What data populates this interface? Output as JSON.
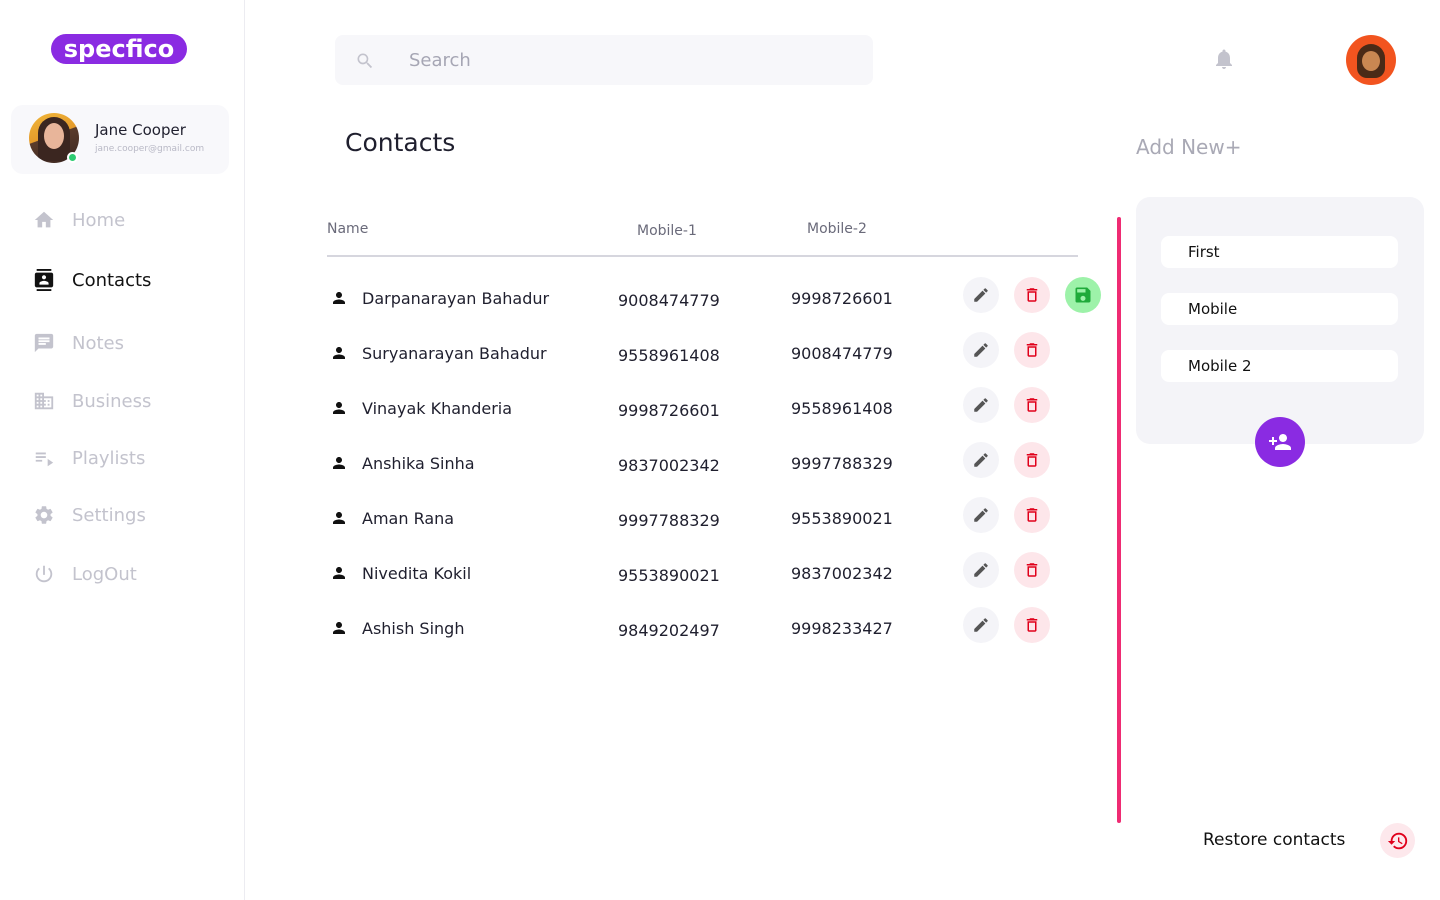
{
  "app": {
    "logo_text": "specfico"
  },
  "user": {
    "name": "Jane Cooper",
    "email": "jane.cooper@gmail.com"
  },
  "sidebar": {
    "items": [
      {
        "label": "Home",
        "icon": "home-icon"
      },
      {
        "label": "Contacts",
        "icon": "contacts-icon",
        "active": true
      },
      {
        "label": "Notes",
        "icon": "notes-icon"
      },
      {
        "label": "Business",
        "icon": "business-icon"
      },
      {
        "label": "Playlists",
        "icon": "playlist-icon"
      },
      {
        "label": "Settings",
        "icon": "gear-icon"
      },
      {
        "label": "LogOut",
        "icon": "power-icon"
      }
    ]
  },
  "search": {
    "placeholder": "Search"
  },
  "page": {
    "title": "Contacts",
    "add_new_label": "Add New+"
  },
  "table": {
    "headers": {
      "name": "Name",
      "mobile1": "Mobile-1",
      "mobile2": "Mobile-2"
    },
    "rows": [
      {
        "name": "Darpanarayan Bahadur",
        "mobile1": "9008474779",
        "mobile2": "9998726601",
        "has_save": true
      },
      {
        "name": "Suryanarayan Bahadur",
        "mobile1": "9558961408",
        "mobile2": "9008474779"
      },
      {
        "name": "Vinayak Khanderia",
        "mobile1": "9998726601",
        "mobile2": "9558961408"
      },
      {
        "name": "Anshika Sinha",
        "mobile1": "9837002342",
        "mobile2": "9997788329"
      },
      {
        "name": "Aman Rana",
        "mobile1": "9997788329",
        "mobile2": "9553890021"
      },
      {
        "name": "Nivedita Kokil",
        "mobile1": "9553890021",
        "mobile2": "9837002342"
      },
      {
        "name": "Ashish Singh",
        "mobile1": "9849202497",
        "mobile2": "9998233427"
      }
    ]
  },
  "form": {
    "first_placeholder": "First",
    "mobile_placeholder": "Mobile",
    "mobile2_placeholder": "Mobile 2"
  },
  "footer": {
    "restore_label": "Restore contacts"
  },
  "colors": {
    "accent_purple": "#8a2be2",
    "divider_pink": "#ef2b73",
    "delete_red": "#e0001b",
    "save_green": "#9df2a9"
  }
}
